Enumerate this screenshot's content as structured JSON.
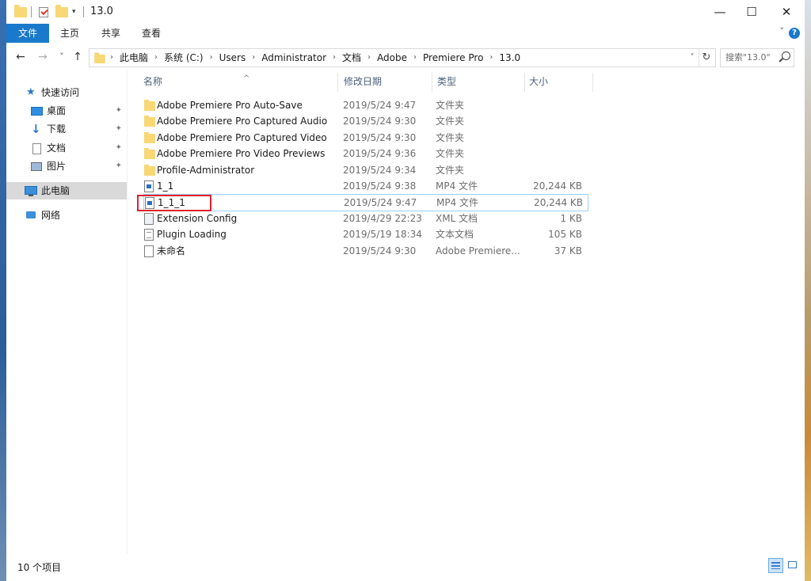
{
  "window": {
    "title": "13.0",
    "controls": {
      "minimize": "—",
      "maximize": "☐",
      "close": "✕"
    }
  },
  "ribbon": {
    "tabs": [
      "文件",
      "主页",
      "共享",
      "查看"
    ],
    "help": "?"
  },
  "nav": {
    "back": "←",
    "forward": "→",
    "recent": "˅",
    "up": "↑",
    "breadcrumbs": [
      "此电脑",
      "系统 (C:)",
      "Users",
      "Administrator",
      "文档",
      "Adobe",
      "Premiere Pro",
      "13.0"
    ],
    "crumb_sep": "›",
    "search_placeholder": "搜索\"13.0\""
  },
  "sidebar": {
    "items": [
      {
        "label": "快速访问",
        "icon": "star-icon"
      },
      {
        "label": "桌面",
        "icon": "desktop-icon",
        "pinned": true
      },
      {
        "label": "下载",
        "icon": "download-icon",
        "pinned": true
      },
      {
        "label": "文档",
        "icon": "document-icon",
        "pinned": true
      },
      {
        "label": "图片",
        "icon": "pictures-icon",
        "pinned": true
      },
      {
        "label": "此电脑",
        "icon": "computer-icon",
        "selected": true
      },
      {
        "label": "网络",
        "icon": "network-icon"
      }
    ]
  },
  "list": {
    "columns": [
      "名称",
      "修改日期",
      "类型",
      "大小"
    ],
    "rows": [
      {
        "name": "Adobe Premiere Pro Auto-Save",
        "date": "2019/5/24 9:47",
        "type": "文件夹",
        "size": "",
        "icon": "folder-icon"
      },
      {
        "name": "Adobe Premiere Pro Captured Audio",
        "date": "2019/5/24 9:30",
        "type": "文件夹",
        "size": "",
        "icon": "folder-icon"
      },
      {
        "name": "Adobe Premiere Pro Captured Video",
        "date": "2019/5/24 9:30",
        "type": "文件夹",
        "size": "",
        "icon": "folder-icon"
      },
      {
        "name": "Adobe Premiere Pro Video Previews",
        "date": "2019/5/24 9:36",
        "type": "文件夹",
        "size": "",
        "icon": "folder-icon"
      },
      {
        "name": "Profile-Administrator",
        "date": "2019/5/24 9:34",
        "type": "文件夹",
        "size": "",
        "icon": "folder-icon"
      },
      {
        "name": "1_1",
        "date": "2019/5/24 9:38",
        "type": "MP4 文件",
        "size": "20,244 KB",
        "icon": "video-file-icon"
      },
      {
        "name": "1_1_1",
        "date": "2019/5/24 9:47",
        "type": "MP4 文件",
        "size": "20,244 KB",
        "icon": "video-file-icon"
      },
      {
        "name": "Extension Config",
        "date": "2019/4/29 22:23",
        "type": "XML 文档",
        "size": "1 KB",
        "icon": "xml-file-icon"
      },
      {
        "name": "Plugin Loading",
        "date": "2019/5/19 18:34",
        "type": "文本文档",
        "size": "105 KB",
        "icon": "text-file-icon"
      },
      {
        "name": "未命名",
        "date": "2019/5/24 9:30",
        "type": "Adobe Premiere...",
        "size": "37 KB",
        "icon": "premiere-file-icon"
      }
    ]
  },
  "status": {
    "item_count": "10 个项目"
  },
  "colors": {
    "accent": "#1979ca",
    "selection_border": "#99d1ff",
    "highlight_box": "#e0212d"
  }
}
